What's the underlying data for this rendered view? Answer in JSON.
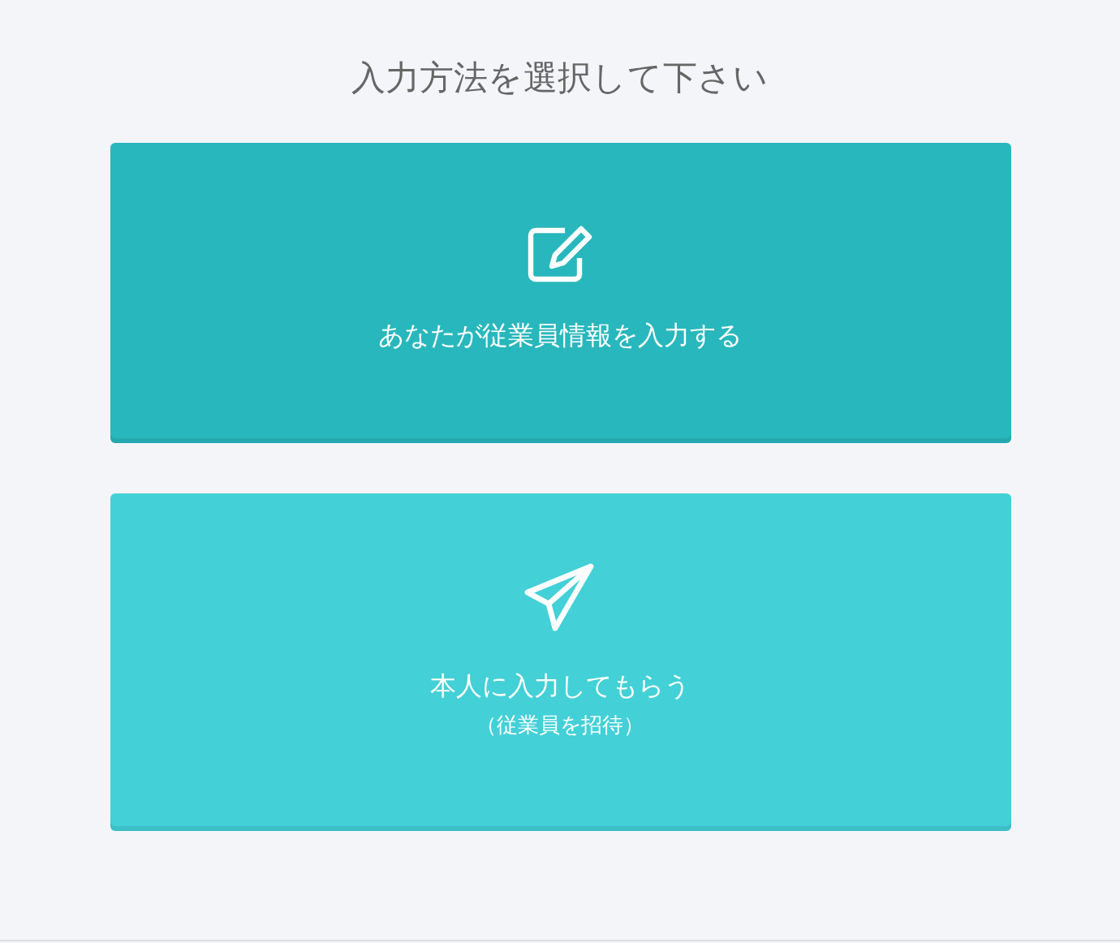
{
  "heading": "入力方法を選択して下さい",
  "options": [
    {
      "kind": "edit",
      "label": "あなたが従業員情報を入力する",
      "color": "#28b7bd"
    },
    {
      "kind": "send",
      "label": "本人に入力してもらう",
      "sublabel": "（従業員を招待）",
      "color": "#43d0d7"
    }
  ]
}
